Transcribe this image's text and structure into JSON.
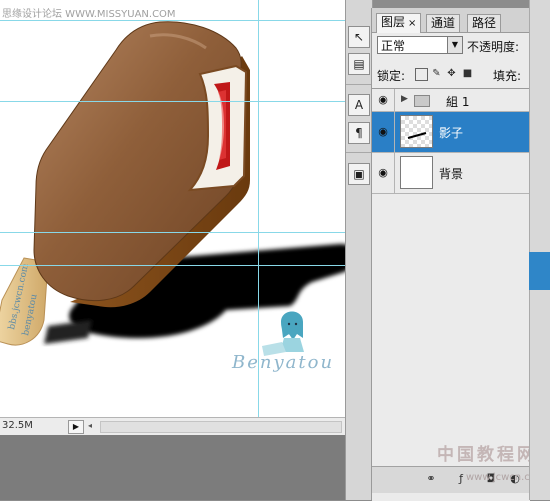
{
  "canvas": {
    "watermark_text": "思缘设计论坛  WWW.MISSYUAN.COM",
    "stick_stamp_1": "bbs.jcwcn.com",
    "stick_stamp_2": "benyatou",
    "signature_text": "Benyatou",
    "zoom_value": "32.5M",
    "status_arrow_icon": "play-right-icon"
  },
  "toolbar": {
    "tools": [
      {
        "name": "path-select-tool",
        "icon": "arrow-cursor-icon",
        "glyph": "↖"
      },
      {
        "name": "notes-tool",
        "icon": "note-stamp-icon",
        "glyph": "▤"
      },
      {
        "name": "character-panel-tool",
        "icon": "character-icon",
        "glyph": "A"
      },
      {
        "name": "paragraph-panel-tool",
        "icon": "pilcrow-icon",
        "glyph": "¶"
      },
      {
        "name": "layer-comps-tool",
        "icon": "layer-comps-icon",
        "glyph": "▣"
      }
    ]
  },
  "layers_panel": {
    "tabs": [
      {
        "label": "图层",
        "active": true,
        "close": "×"
      },
      {
        "label": "通道",
        "active": false
      },
      {
        "label": "路径",
        "active": false
      }
    ],
    "blend_mode": "正常",
    "opacity_label": "不透明度:",
    "lock_label": "锁定:",
    "fill_label": "填充:",
    "layers": [
      {
        "name": "組 1",
        "type": "group",
        "visible": true,
        "selected": false
      },
      {
        "name": "影子",
        "type": "layer",
        "visible": true,
        "selected": true
      },
      {
        "name": "背景",
        "type": "background",
        "visible": true,
        "selected": false
      }
    ],
    "footer_icons": [
      "link-icon",
      "fx-icon",
      "mask-icon",
      "adjustment-icon"
    ]
  },
  "branding": {
    "site_watermark": "中国教程网",
    "site_url": "www.jcwcn.com"
  },
  "colors": {
    "selection_blue": "#2a7fc6",
    "chocolate": "#8a5a34",
    "stick": "#e2c48a",
    "bite_red": "#c01818",
    "guide_cyan": "#88d8e8"
  }
}
